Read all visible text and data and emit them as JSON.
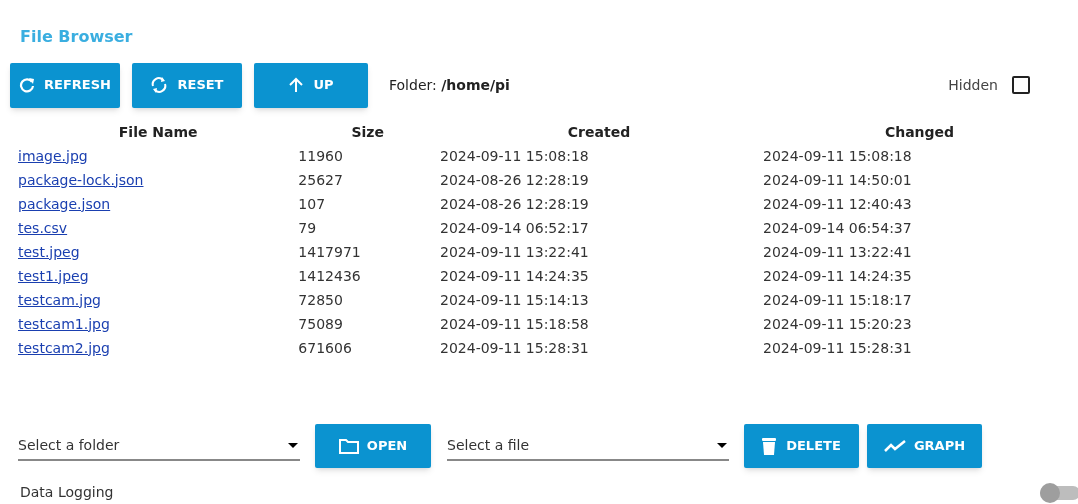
{
  "title": "File Browser",
  "toolbar": {
    "buttons": [
      {
        "kind": "refresh",
        "label": "REFRESH"
      },
      {
        "kind": "reset",
        "label": "RESET"
      },
      {
        "kind": "up",
        "label": "UP"
      }
    ],
    "folder_label": "Folder:",
    "folder": "/home/pi",
    "hidden_label": "Hidden",
    "hidden_checked": false
  },
  "table": {
    "columns": [
      "File Name",
      "Size",
      "Created",
      "Changed"
    ],
    "rows": [
      [
        "image.jpg",
        "11960",
        "2024-09-11 15:08:18",
        "2024-09-11 15:08:18"
      ],
      [
        "package-lock.json",
        "25627",
        "2024-08-26 12:28:19",
        "2024-09-11 14:50:01"
      ],
      [
        "package.json",
        "107",
        "2024-08-26 12:28:19",
        "2024-09-11 12:40:43"
      ],
      [
        "tes.csv",
        "79",
        "2024-09-14 06:52:17",
        "2024-09-14 06:54:37"
      ],
      [
        "test.jpeg",
        "1417971",
        "2024-09-11 13:22:41",
        "2024-09-11 13:22:41"
      ],
      [
        "test1.jpeg",
        "1412436",
        "2024-09-11 14:24:35",
        "2024-09-11 14:24:35"
      ],
      [
        "testcam.jpg",
        "72850",
        "2024-09-11 15:14:13",
        "2024-09-11 15:18:17"
      ],
      [
        "testcam1.jpg",
        "75089",
        "2024-09-11 15:18:58",
        "2024-09-11 15:20:23"
      ],
      [
        "testcam2.jpg",
        "671606",
        "2024-09-11 15:28:31",
        "2024-09-11 15:28:31"
      ]
    ]
  },
  "actions": {
    "folder_select": {
      "placeholder": "Select a folder"
    },
    "open_button": "OPEN",
    "file_select": {
      "placeholder": "Select a file"
    },
    "delete_button": "DELETE",
    "graph_button": "GRAPH"
  },
  "data_logging": {
    "label": "Data Logging",
    "on": false
  }
}
